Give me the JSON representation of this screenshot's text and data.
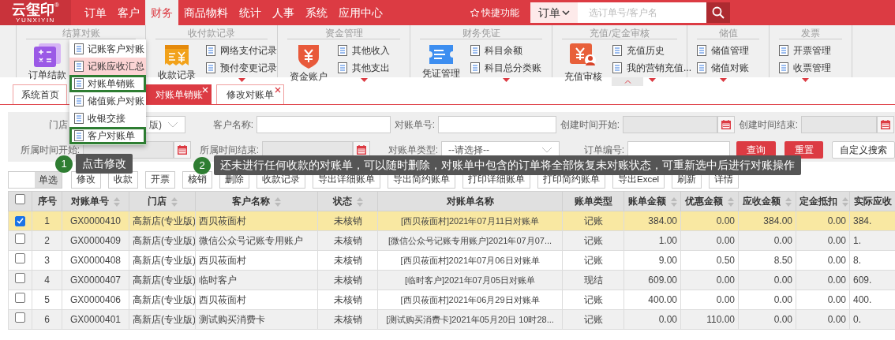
{
  "header": {
    "logo": {
      "text": "云玺印",
      "mark": "®",
      "subtitle": "YUNXIYIN"
    },
    "nav": [
      {
        "label": "订单",
        "selected": false
      },
      {
        "label": "客户",
        "selected": false
      },
      {
        "label": "财务",
        "selected": true
      },
      {
        "label": "商品物料",
        "selected": false
      },
      {
        "label": "统计",
        "selected": false
      },
      {
        "label": "人事",
        "selected": false
      },
      {
        "label": "系统",
        "selected": false
      },
      {
        "label": "应用中心",
        "selected": false
      }
    ],
    "quick_access": "快捷功能",
    "search": {
      "scope": "订单",
      "placeholder": "选订单号/客户名"
    }
  },
  "ribbon": {
    "groups": [
      {
        "title": "结算对账",
        "big": {
          "label": "订单结款"
        }
      },
      {
        "title": "收付款记录",
        "big": {
          "label": "收款记录"
        },
        "items": [
          "网络支付记录",
          "预付变更记录"
        ],
        "more": true
      },
      {
        "title": "资金管理",
        "big": {
          "label": "资金账户"
        },
        "items": [
          "其他收入",
          "其他支出"
        ],
        "more": true
      },
      {
        "title": "财务凭证",
        "big": {
          "label": "凭证管理"
        },
        "items": [
          "科目余额",
          "科目总分类账"
        ],
        "more": true
      },
      {
        "title": "充值/定金审核",
        "big": {
          "label": "充值审核"
        },
        "items": [
          "充值历史",
          "我的营销充值..."
        ],
        "more": true
      },
      {
        "title": "储值",
        "items": [
          "储值管理",
          "储值对账"
        ],
        "more": true
      },
      {
        "title": "发票",
        "items": [
          "开票管理",
          "收票管理"
        ],
        "more": true
      }
    ],
    "menu": [
      {
        "label": "记账客户对账",
        "hovered": false,
        "highlighted": false
      },
      {
        "label": "记账应收汇总",
        "hovered": true,
        "highlighted": false
      },
      {
        "label": "对账单销账",
        "hovered": false,
        "highlighted": true
      },
      {
        "label": "储值账户对账",
        "hovered": false,
        "highlighted": false
      },
      {
        "label": "收银交接",
        "hovered": false,
        "highlighted": false
      },
      {
        "label": "客户对账单",
        "hovered": false,
        "highlighted": true
      }
    ]
  },
  "tabs": [
    {
      "label": "系统首页",
      "selected": false,
      "closable": false
    },
    {
      "label": "对账单销账",
      "selected": true,
      "closable": true
    },
    {
      "label": "修改对账单",
      "selected": false,
      "closable": true
    }
  ],
  "filters": [
    {
      "label": "门店",
      "kind": "select",
      "value": "版)"
    },
    {
      "label": "客户名称:",
      "kind": "text"
    },
    {
      "label": "对账单号:",
      "kind": "text"
    },
    {
      "label": "创建时间开始:",
      "kind": "date"
    },
    {
      "label": "创建时间结束:",
      "kind": "date"
    },
    {
      "label": "所属时间开始:",
      "kind": "date"
    },
    {
      "label": "所属时间结束:",
      "kind": "date"
    },
    {
      "label": "对账单类型:",
      "kind": "select",
      "value": "--请选择--"
    },
    {
      "label": "订单编号:",
      "kind": "text"
    }
  ],
  "filter_buttons": [
    {
      "label": "查询",
      "primary": true
    },
    {
      "label": "重置",
      "primary": true
    },
    {
      "label": "自定义搜索",
      "primary": false
    }
  ],
  "toolbar": {
    "select_mode": "单选",
    "buttons": [
      "修改",
      "收款",
      "开票",
      "核销",
      "删除",
      "收款记录",
      "导出详细账单",
      "导出简约账单",
      "打印详细账单",
      "打印简约账单",
      "导出Excel",
      "刷新",
      "详情"
    ]
  },
  "guides": [
    {
      "number": "1",
      "text": "点击修改"
    },
    {
      "number": "2",
      "text": "还未进行任何收款的对账单，可以随时删除，对账单中包含的订单将全部恢复未对账状态，可重新选中后进行对账操作"
    }
  ],
  "table": {
    "select_all": {
      "checked": false
    },
    "columns": [
      {
        "label": "序号",
        "sortable": false
      },
      {
        "label": "对账单号",
        "sortable": true
      },
      {
        "label": "门店",
        "sortable": true
      },
      {
        "label": "客户名称",
        "sortable": true
      },
      {
        "label": "状态",
        "sortable": true
      },
      {
        "label": "对账单名称",
        "sortable": false
      },
      {
        "label": "账单类型",
        "sortable": false
      },
      {
        "label": "账单金额",
        "sortable": true
      },
      {
        "label": "优惠金额",
        "sortable": true
      },
      {
        "label": "应收金额",
        "sortable": true
      },
      {
        "label": "定金抵扣",
        "sortable": true
      },
      {
        "label": "实际应收",
        "sortable": false
      }
    ],
    "rows": [
      {
        "selected": true,
        "cells": [
          "1",
          "GX0000410",
          "高新店(专业版)",
          "西贝莜面村",
          "未核销",
          "[西贝莜面村]2021年07月11日对账单",
          "记账",
          "384.00",
          "0.00",
          "384.00",
          "0.00",
          "384."
        ]
      },
      {
        "selected": false,
        "cells": [
          "2",
          "GX0000409",
          "高新店(专业版)",
          "微信公众号记账专用账户",
          "未核销",
          "[微信公众号记账专用账户]2021年07月07...",
          "记账",
          "1.00",
          "0.00",
          "0.00",
          "0.00",
          "1."
        ]
      },
      {
        "selected": false,
        "cells": [
          "3",
          "GX0000408",
          "高新店(专业版)",
          "西贝莜面村",
          "未核销",
          "[西贝莜面村]2021年07月06日对账单",
          "记账",
          "9.00",
          "0.50",
          "8.50",
          "0.00",
          "8."
        ]
      },
      {
        "selected": false,
        "cells": [
          "4",
          "GX0000407",
          "高新店(专业版)",
          "临时客户",
          "未核销",
          "[临时客户]2021年07月05日对账单",
          "现结",
          "609.00",
          "0.00",
          "0.00",
          "0.00",
          "609."
        ]
      },
      {
        "selected": false,
        "cells": [
          "5",
          "GX0000406",
          "高新店(专业版)",
          "西贝莜面村",
          "未核销",
          "[西贝莜面村]2021年06月29日对账单",
          "记账",
          "400.00",
          "0.00",
          "0.00",
          "0.00",
          "400."
        ]
      },
      {
        "selected": false,
        "cells": [
          "6",
          "GX0000401",
          "高新店(专业版)",
          "测试购买消费卡",
          "未核销",
          "[测试购买消费卡]2021年05月20日 10时28...",
          "记账",
          "0.00",
          "110.00",
          "0.00",
          "0.00",
          "0."
        ]
      }
    ]
  }
}
